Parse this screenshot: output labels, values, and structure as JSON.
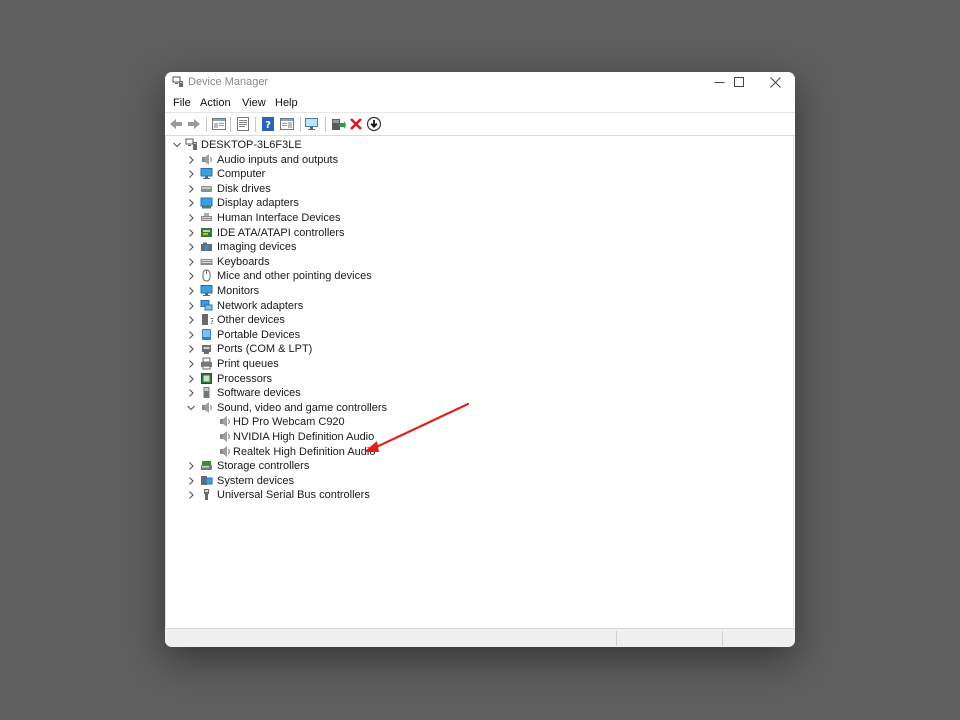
{
  "window": {
    "title": "Device Manager",
    "icon": "device-manager-icon"
  },
  "window_buttons": [
    "minimize-icon",
    "maximize-icon",
    "close-icon"
  ],
  "menu": [
    "File",
    "Action",
    "View",
    "Help"
  ],
  "toolbar": [
    "back-arrow-icon",
    "forward-arrow-icon",
    "show-hide-console-tree-icon",
    "properties-icon",
    "help-icon",
    "action-pane-icon",
    "scan-hardware-icon",
    "update-driver-icon",
    "uninstall-device-icon",
    "disable-device-icon"
  ],
  "tree": {
    "root": "DESKTOP-3L6F3LE",
    "categories": [
      {
        "label": "Audio inputs and outputs",
        "icon": "speaker-icon"
      },
      {
        "label": "Computer",
        "icon": "computer-icon"
      },
      {
        "label": "Disk drives",
        "icon": "disk-drive-icon"
      },
      {
        "label": "Display adapters",
        "icon": "display-adapter-icon"
      },
      {
        "label": "Human Interface Devices",
        "icon": "hid-icon"
      },
      {
        "label": "IDE ATA/ATAPI controllers",
        "icon": "ide-controller-icon"
      },
      {
        "label": "Imaging devices",
        "icon": "camera-icon"
      },
      {
        "label": "Keyboards",
        "icon": "keyboard-icon"
      },
      {
        "label": "Mice and other pointing devices",
        "icon": "mouse-icon"
      },
      {
        "label": "Monitors",
        "icon": "monitor-icon"
      },
      {
        "label": "Network adapters",
        "icon": "network-adapter-icon"
      },
      {
        "label": "Other devices",
        "icon": "unknown-device-icon"
      },
      {
        "label": "Portable Devices",
        "icon": "portable-device-icon"
      },
      {
        "label": "Ports (COM & LPT)",
        "icon": "port-icon"
      },
      {
        "label": "Print queues",
        "icon": "printer-icon"
      },
      {
        "label": "Processors",
        "icon": "processor-icon"
      },
      {
        "label": "Software devices",
        "icon": "software-device-icon"
      },
      {
        "label": "Sound, video and game controllers",
        "icon": "speaker-icon",
        "expanded": true,
        "children": [
          {
            "label": "HD Pro Webcam C920",
            "icon": "speaker-icon"
          },
          {
            "label": "NVIDIA High Definition Audio",
            "icon": "speaker-icon"
          },
          {
            "label": "Realtek High Definition Audio",
            "icon": "speaker-icon",
            "highlighted": true
          }
        ]
      },
      {
        "label": "Storage controllers",
        "icon": "storage-controller-icon"
      },
      {
        "label": "System devices",
        "icon": "system-device-icon"
      },
      {
        "label": "Universal Serial Bus controllers",
        "icon": "usb-icon"
      }
    ]
  },
  "annotation": {
    "icon": "red-arrow-icon",
    "color": "#e0201b",
    "points_to": "Realtek High Definition Audio"
  },
  "colors": {
    "background": "#5f5f5f",
    "window": "#ffffff",
    "accent_blue": "#1a73c8",
    "arrow_red": "#e0201b"
  }
}
